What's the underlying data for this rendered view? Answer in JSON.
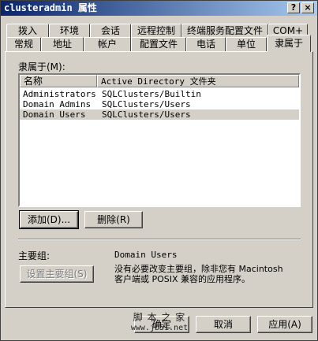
{
  "title": "clusteradmin 属性",
  "caption_buttons": {
    "help": "?",
    "close": "×"
  },
  "tabs_back": [
    "拨入",
    "环境",
    "会话",
    "远程控制",
    "终端服务配置文件",
    "COM+"
  ],
  "tabs_front": [
    "常规",
    "地址",
    "帐户",
    "配置文件",
    "电话",
    "单位",
    "隶属于"
  ],
  "active_tab": "隶属于",
  "member_of_label": "隶属于(M):",
  "list": {
    "columns": [
      "名称",
      "Active Directory 文件夹"
    ],
    "rows": [
      {
        "name": "Administrators",
        "folder": "SQLClusters/Builtin",
        "selected": false
      },
      {
        "name": "Domain Admins",
        "folder": "SQLClusters/Users",
        "selected": false
      },
      {
        "name": "Domain Users",
        "folder": "SQLClusters/Users",
        "selected": true
      }
    ]
  },
  "buttons": {
    "add": "添加(D)...",
    "remove": "删除(R)",
    "set_primary": "设置主要组(S)",
    "ok": "确定",
    "cancel": "取消",
    "apply": "应用(A)"
  },
  "primary_group": {
    "label": "主要组:",
    "value": "Domain Users",
    "note_line1": "没有必要改变主要组，除非您有 Macintosh",
    "note_line2": "客户端或 POSIX 兼容的应用程序。"
  },
  "watermark": {
    "line1": "脚 本 之 家",
    "line2": "www.jb51.net"
  }
}
